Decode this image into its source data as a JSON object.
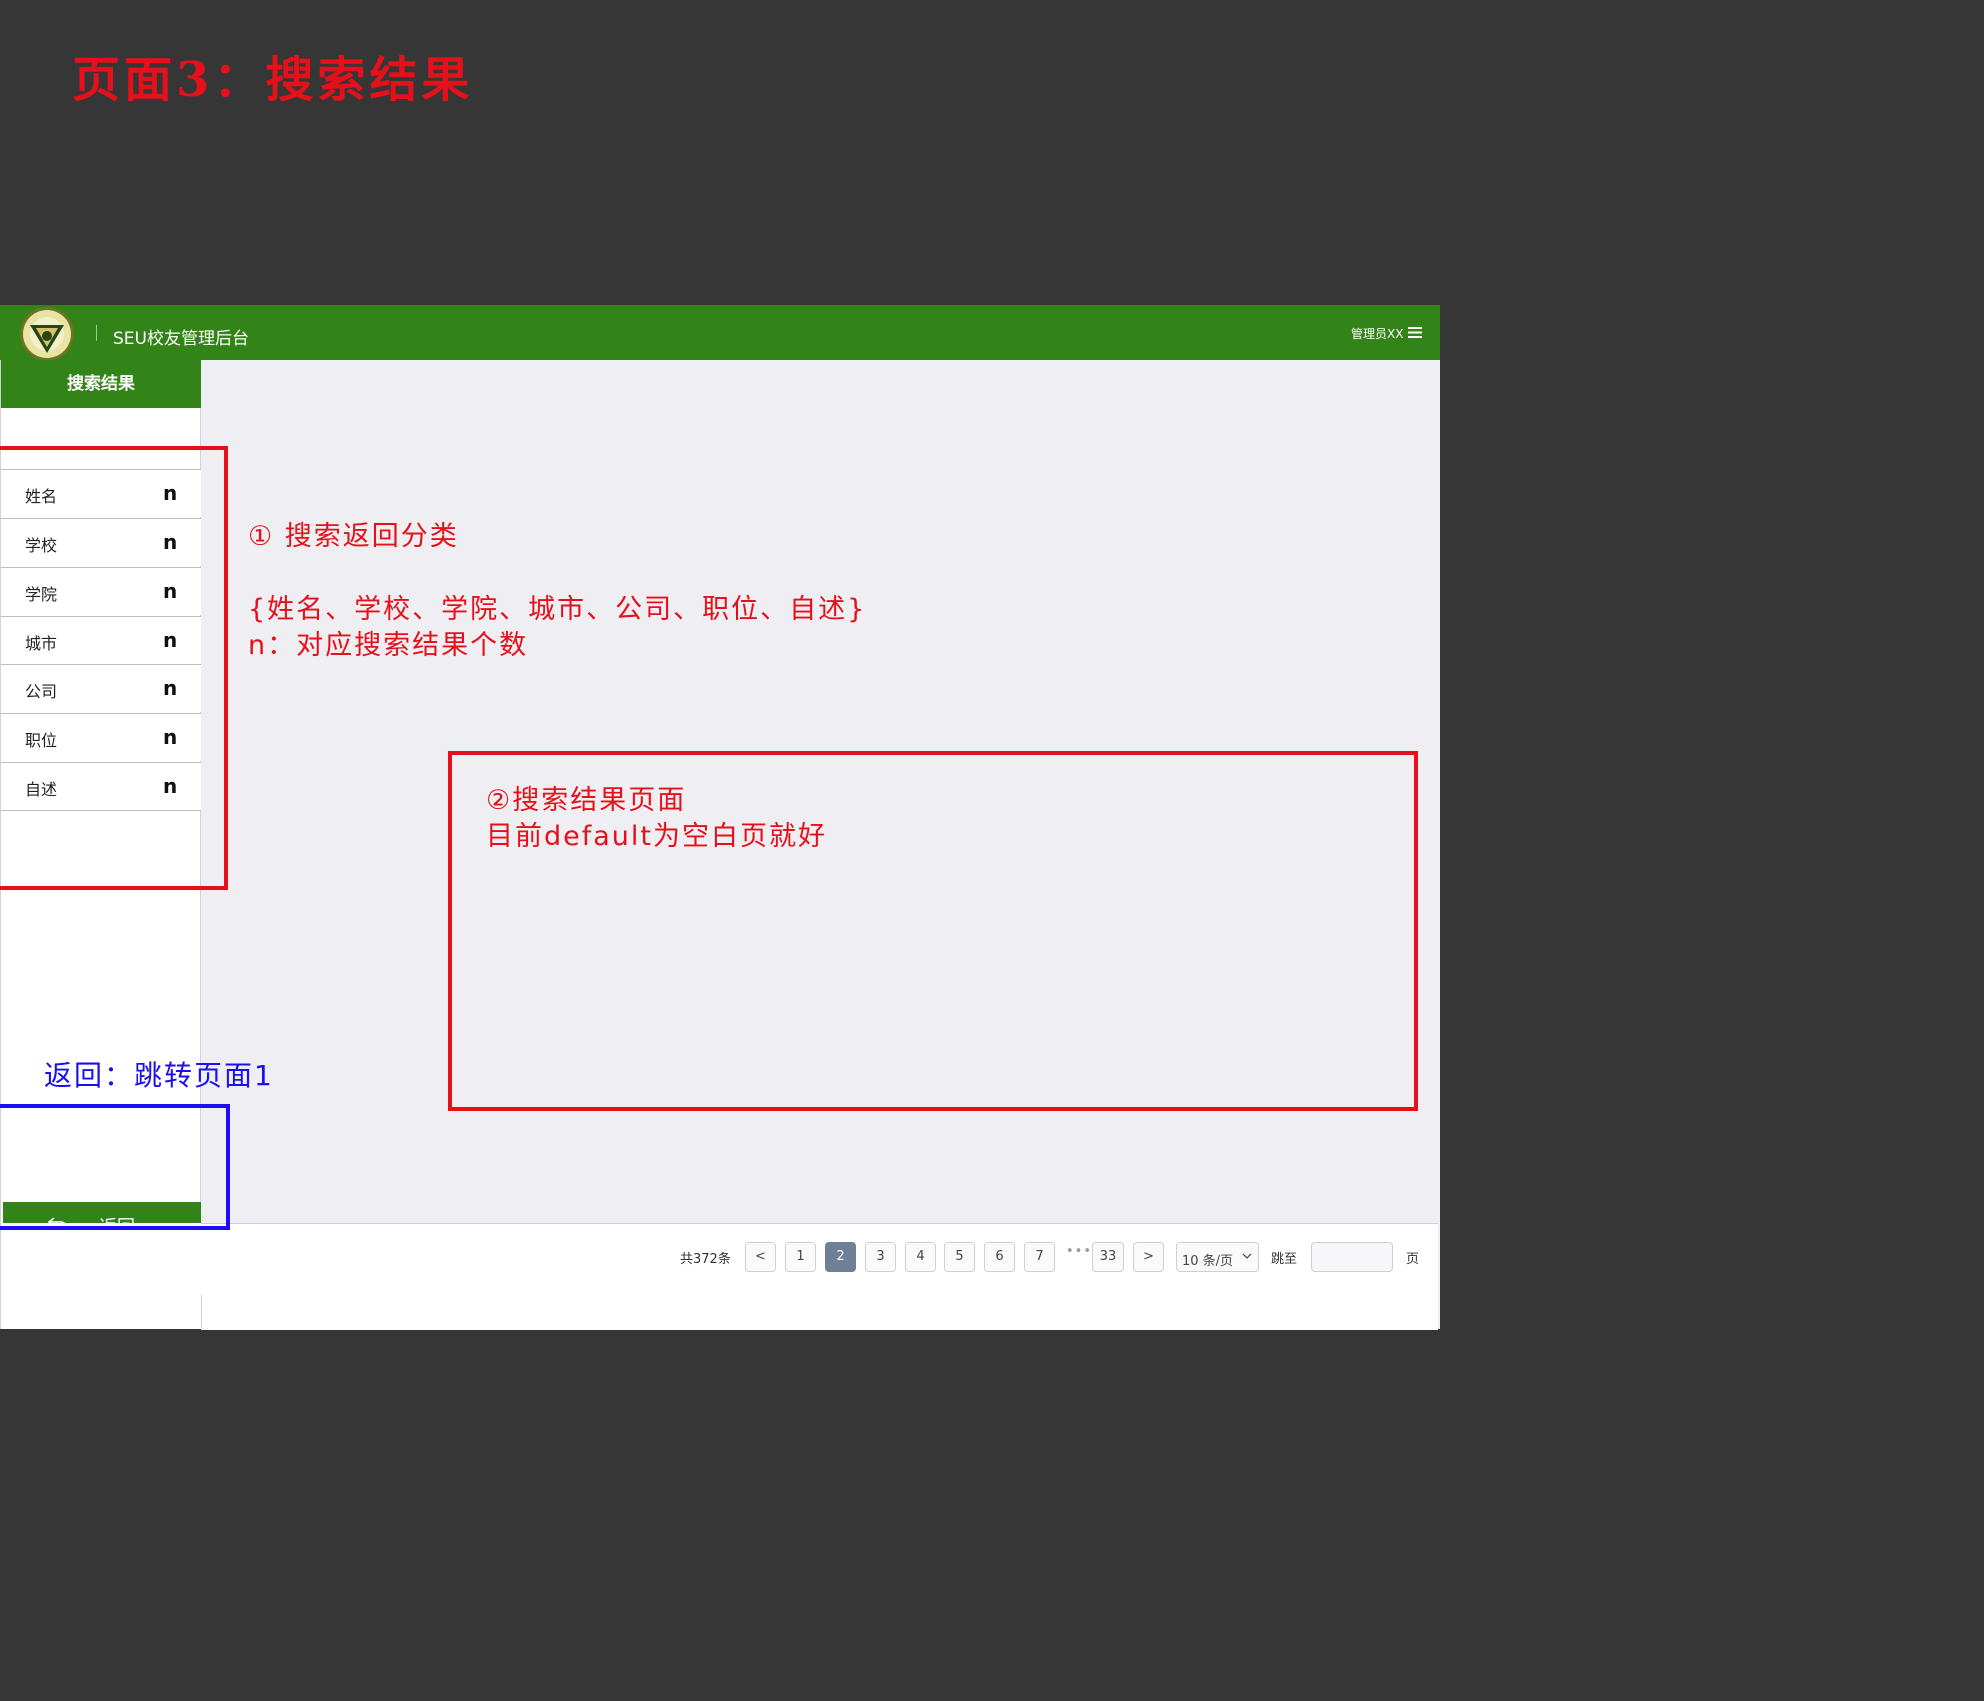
{
  "page_heading": "页面3：搜索结果",
  "topbar": {
    "app_title": "SEU校友管理后台",
    "admin_label": "管理员XX"
  },
  "sidebar": {
    "header": "搜索结果",
    "categories": [
      {
        "label": "姓名",
        "count": "n"
      },
      {
        "label": "学校",
        "count": "n"
      },
      {
        "label": "学院",
        "count": "n"
      },
      {
        "label": "城市",
        "count": "n"
      },
      {
        "label": "公司",
        "count": "n"
      },
      {
        "label": "职位",
        "count": "n"
      },
      {
        "label": "自述",
        "count": "n"
      }
    ],
    "back_label": "返回"
  },
  "pagination": {
    "total_label": "共372条",
    "prev": "<",
    "next": ">",
    "pages": [
      "1",
      "2",
      "3",
      "4",
      "5",
      "6",
      "7"
    ],
    "ellipsis": "•••",
    "last_page": "33",
    "current_page": "2",
    "page_size": "10 条/页",
    "jump_label": "跳至",
    "page_unit": "页"
  },
  "annotations": {
    "note_1_title": "① 搜索返回分类",
    "note_1_list": "{姓名、学校、学院、城市、公司、职位、自述}",
    "note_1_n": "n：对应搜索结果个数",
    "note_2_title": "②搜索结果页面",
    "note_2_body": "目前default为空白页就好",
    "note_back": "返回：跳转页面1"
  },
  "colors": {
    "background": "#363636",
    "brand_green": "#328318",
    "content_bg": "#efeef3",
    "annotation_red": "#e6101a",
    "annotation_blue": "#1c0ef0",
    "active_page": "#6f7f95"
  },
  "icons": {
    "logo": "university-seal-logo",
    "menu": "hamburger-menu-icon",
    "back": "return-arrow-icon",
    "dropdown": "chevron-down-icon"
  }
}
